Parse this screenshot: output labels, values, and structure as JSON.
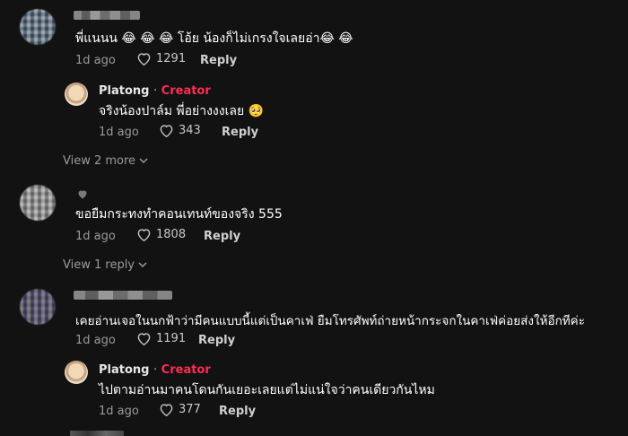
{
  "comments": [
    {
      "text": "พี่แนนน 😂 😂 😂  โอ้ย น้องก็ไม่เกรงใจเลยอ่า😂 😂",
      "time": "1d ago",
      "likes": "1291",
      "reply_label": "Reply",
      "reply": {
        "author": "Platong",
        "separator": "·",
        "badge": "Creator",
        "text": "จริงน้องปาล์ม พี่อย่างงงเลย 🥺",
        "time": "1d ago",
        "likes": "343",
        "reply_label": "Reply"
      },
      "view_more": "View 2 more"
    },
    {
      "text": "ขอยืมกระทงทำคอนเทนท์ของจริง 555",
      "time": "1d ago",
      "likes": "1808",
      "reply_label": "Reply",
      "view_more": "View 1 reply"
    },
    {
      "text": "เคยอ่านเจอในนกฟ้าว่ามีคนแบบนี้แต่เป็นคาเฟ่ ยืมโทรศัพท์ถ่ายหน้ากระจกในคาเฟ่ค่อยส่งให้อีกทีค่ะ",
      "time": "1d ago",
      "likes": "1191",
      "reply_label": "Reply",
      "reply": {
        "author": "Platong",
        "separator": "·",
        "badge": "Creator",
        "text": "ไปตามอ่านมาคนโดนกันเยอะเลยแต่ไม่แน่ใจว่าคนเดียวกันไหม",
        "time": "1d ago",
        "likes": "377",
        "reply_label": "Reply"
      }
    }
  ],
  "colors": {
    "background": "#121212",
    "creator_badge": "#fe2c55",
    "meta": "#9a9a9a"
  }
}
